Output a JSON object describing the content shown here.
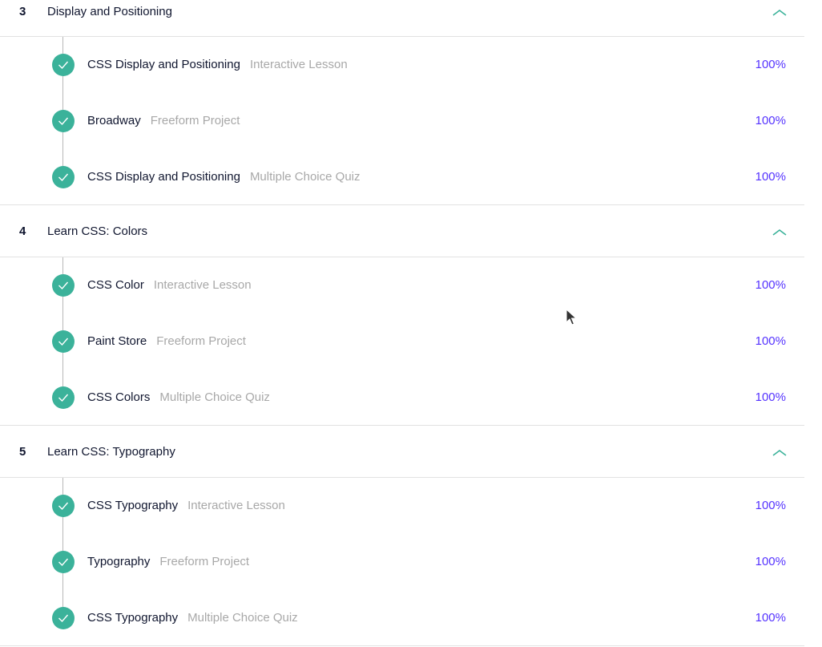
{
  "modules": [
    {
      "number": "3",
      "title": "Display and Positioning",
      "items": [
        {
          "title": "CSS Display and Positioning",
          "type": "Interactive Lesson",
          "percent": "100%"
        },
        {
          "title": "Broadway",
          "type": "Freeform Project",
          "percent": "100%"
        },
        {
          "title": "CSS Display and Positioning",
          "type": "Multiple Choice Quiz",
          "percent": "100%"
        }
      ]
    },
    {
      "number": "4",
      "title": "Learn CSS: Colors",
      "items": [
        {
          "title": "CSS Color",
          "type": "Interactive Lesson",
          "percent": "100%"
        },
        {
          "title": "Paint Store",
          "type": "Freeform Project",
          "percent": "100%"
        },
        {
          "title": "CSS Colors",
          "type": "Multiple Choice Quiz",
          "percent": "100%"
        }
      ]
    },
    {
      "number": "5",
      "title": "Learn CSS: Typography",
      "items": [
        {
          "title": "CSS Typography",
          "type": "Interactive Lesson",
          "percent": "100%"
        },
        {
          "title": "Typography",
          "type": "Freeform Project",
          "percent": "100%"
        },
        {
          "title": "CSS Typography",
          "type": "Multiple Choice Quiz",
          "percent": "100%"
        }
      ]
    }
  ],
  "icons": {
    "completed": "check-circle-icon",
    "collapse": "chevron-up-icon",
    "cursor": "mouse-pointer-icon"
  },
  "colors": {
    "text": "#10162f",
    "muted": "#a8a8a8",
    "accent_percent": "#5533ff",
    "check_green": "#3bb29a",
    "chevron_teal": "#3bb29a",
    "divider": "#e2e2e2"
  }
}
